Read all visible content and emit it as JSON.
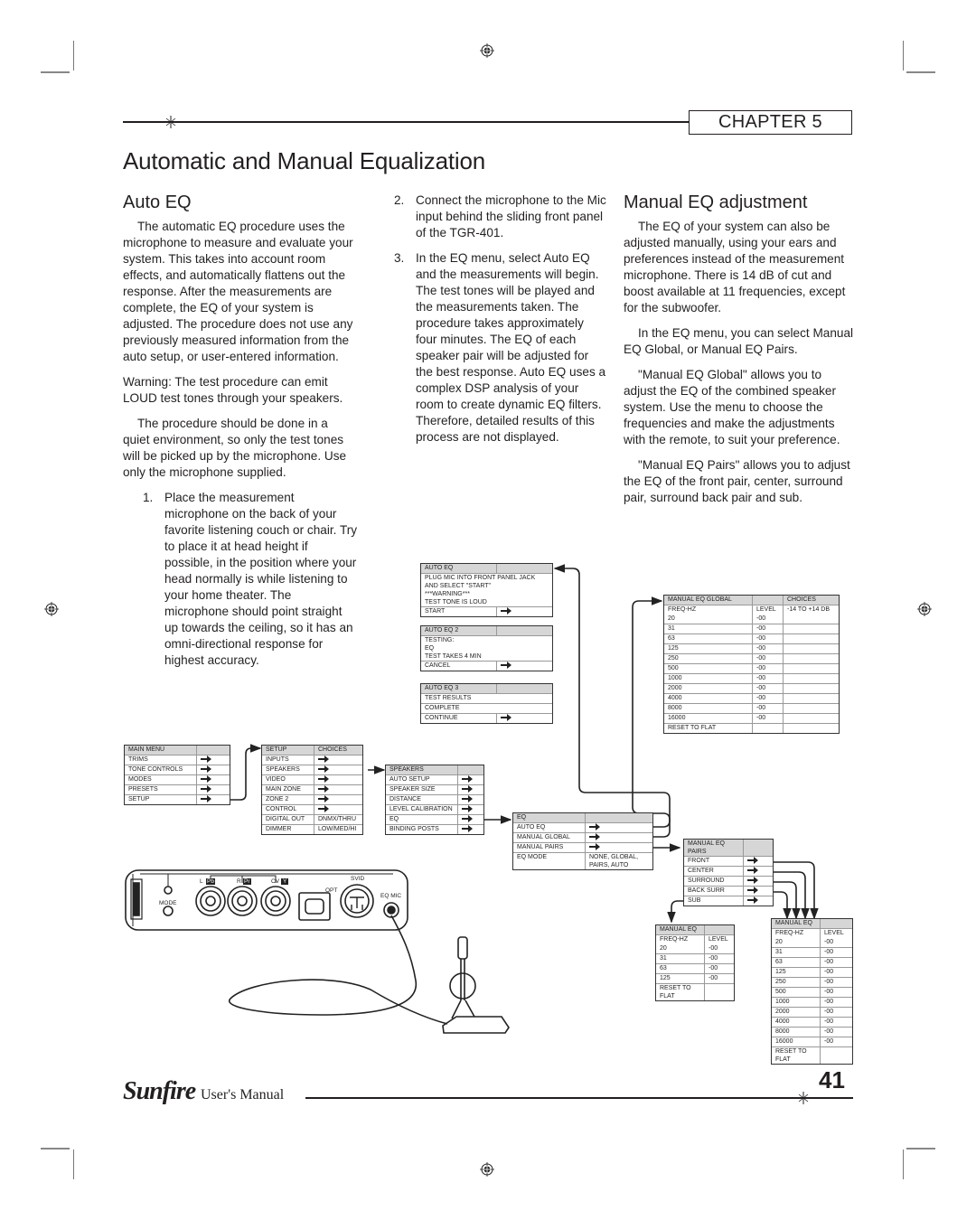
{
  "header": {
    "chapter_label": "CHAPTER 5",
    "page_title": "Automatic and Manual Equalization"
  },
  "col1": {
    "heading": "Auto EQ",
    "p1": "The automatic EQ procedure uses the microphone to measure and evaluate your system. This takes into account room effects, and automatically flattens out the response. After the measurements are complete, the EQ of your system is adjusted. The procedure does not use any previously measured information from the auto setup, or user-entered information.",
    "p2": "Warning: The test procedure can emit LOUD test tones through your speakers.",
    "p3": "The procedure should be done in a quiet environment, so only the test tones will be picked up by the microphone. Use only the microphone supplied.",
    "step1_num": "1.",
    "step1": "Place the measurement microphone on the back of your favorite listening couch or chair. Try to place it at head height if possible, in the position where your head normally is while listening to your home theater. The microphone should point straight up towards the ceiling, so it has an omni-directional response for highest accuracy."
  },
  "col2": {
    "step2_num": "2.",
    "step2": "Connect the microphone to the Mic input behind the sliding front panel of the TGR-401.",
    "step3_num": "3.",
    "step3": "In the EQ menu, select Auto EQ and the measurements will begin. The test tones will be played and the measurements taken. The procedure takes approximately four minutes. The EQ of each speaker pair will be adjusted for the best response. Auto EQ uses a complex DSP analysis of your room to create dynamic EQ filters. Therefore, detailed results of this process are not displayed."
  },
  "col3": {
    "heading": "Manual EQ adjustment",
    "p1": "The EQ of your system can also be adjusted manually, using your ears and preferences instead of the measurement microphone. There is 14 dB of cut and boost available at 11 frequencies, except for the subwoofer.",
    "p2": "In the EQ menu, you can select Manual EQ Global, or Manual EQ Pairs.",
    "p3": "\"Manual EQ Global\" allows you to adjust the EQ of the combined speaker system. Use the menu to choose the frequencies and make the adjustments with the remote, to suit your preference.",
    "p4": "\"Manual EQ Pairs\" allows you to adjust the EQ of the front pair, center, surround pair, surround back pair and sub."
  },
  "menus": {
    "auto_eq": {
      "title": "AUTO EQ",
      "lines": [
        "PLUG MIC INTO FRONT PANEL JACK",
        "AND SELECT \"START\"",
        "***WARNING***",
        "TEST TONE IS LOUD"
      ],
      "action": "START"
    },
    "auto_eq2": {
      "title": "AUTO EQ 2",
      "lines": [
        "TESTING:",
        "EQ",
        "TEST TAKES 4 MIN"
      ],
      "action": "CANCEL"
    },
    "auto_eq3": {
      "title": "AUTO EQ 3",
      "rows": [
        "TEST RESULTS",
        "COMPLETE"
      ],
      "action": "CONTINUE"
    },
    "main_menu": {
      "title": "MAIN MENU",
      "items": [
        "TRIMS",
        "TONE CONTROLS",
        "MODES",
        "PRESETS",
        "SETUP"
      ]
    },
    "setup": {
      "title": "SETUP",
      "choices_header": "CHOICES",
      "items": [
        {
          "label": "INPUTS",
          "choice": ""
        },
        {
          "label": "SPEAKERS",
          "choice": ""
        },
        {
          "label": "VIDEO",
          "choice": ""
        },
        {
          "label": "MAIN ZONE",
          "choice": ""
        },
        {
          "label": "ZONE 2",
          "choice": ""
        },
        {
          "label": "CONTROL",
          "choice": ""
        },
        {
          "label": "DIGITAL OUT",
          "choice": "DNMX/THRU"
        },
        {
          "label": "DIMMER",
          "choice": "LOW/MED/HI"
        }
      ]
    },
    "speakers": {
      "title": "SPEAKERS",
      "items": [
        "AUTO SETUP",
        "SPEAKER SIZE",
        "DISTANCE",
        "LEVEL CALIBRATION",
        "EQ",
        "BINDING POSTS"
      ]
    },
    "eq": {
      "title": "EQ",
      "items": [
        {
          "label": "AUTO EQ",
          "choice": ""
        },
        {
          "label": "MANUAL GLOBAL",
          "choice": ""
        },
        {
          "label": "MANUAL PAIRS",
          "choice": ""
        },
        {
          "label": "EQ MODE",
          "choice": "NONE, GLOBAL, PAIRS, AUTO"
        }
      ]
    },
    "manual_eq_global": {
      "title": "MANUAL EQ GLOBAL",
      "choices_header": "CHOICES",
      "freq_header": "FREQ-HZ",
      "level_header": "LEVEL",
      "choices_value": "-14 TO +14 DB",
      "rows": [
        {
          "freq": "20",
          "level": "-00"
        },
        {
          "freq": "31",
          "level": "-00"
        },
        {
          "freq": "63",
          "level": "-00"
        },
        {
          "freq": "125",
          "level": "-00"
        },
        {
          "freq": "250",
          "level": "-00"
        },
        {
          "freq": "500",
          "level": "-00"
        },
        {
          "freq": "1000",
          "level": "-00"
        },
        {
          "freq": "2000",
          "level": "-00"
        },
        {
          "freq": "4000",
          "level": "-00"
        },
        {
          "freq": "8000",
          "level": "-00"
        },
        {
          "freq": "16000",
          "level": "-00"
        }
      ],
      "reset": "RESET TO FLAT"
    },
    "manual_eq_pairs": {
      "title": "MANUAL EQ PAIRS",
      "items": [
        "FRONT",
        "CENTER",
        "SURROUND",
        "BACK SURR",
        "SUB"
      ]
    },
    "manual_eq_sub": {
      "title": "MANUAL EQ",
      "freq_header": "FREQ-HZ",
      "level_header": "LEVEL",
      "rows": [
        {
          "freq": "20",
          "level": "-00"
        },
        {
          "freq": "31",
          "level": "-00"
        },
        {
          "freq": "63",
          "level": "-00"
        },
        {
          "freq": "125",
          "level": "-00"
        }
      ],
      "reset": "RESET TO FLAT"
    },
    "manual_eq_pair": {
      "title": "MANUAL EQ",
      "freq_header": "FREQ-HZ",
      "level_header": "LEVEL",
      "rows": [
        {
          "freq": "20",
          "level": "-00"
        },
        {
          "freq": "31",
          "level": "-00"
        },
        {
          "freq": "63",
          "level": "-00"
        },
        {
          "freq": "125",
          "level": "-00"
        },
        {
          "freq": "250",
          "level": "-00"
        },
        {
          "freq": "500",
          "level": "-00"
        },
        {
          "freq": "1000",
          "level": "-00"
        },
        {
          "freq": "2000",
          "level": "-00"
        },
        {
          "freq": "4000",
          "level": "-00"
        },
        {
          "freq": "8000",
          "level": "-00"
        },
        {
          "freq": "16000",
          "level": "-00"
        }
      ],
      "reset": "RESET TO FLAT"
    }
  },
  "device": {
    "labels": {
      "mode": "MODE",
      "l": "L",
      "l_badge": "Pb",
      "r": "R",
      "r_badge": "Pr",
      "cv": "CV",
      "cv_badge": "Y",
      "opt": "OPT",
      "svid": "SVID",
      "eq_mic": "EQ MIC"
    }
  },
  "footer": {
    "brand": "Sunfire",
    "manual": "User's Manual",
    "page_number": "41"
  }
}
